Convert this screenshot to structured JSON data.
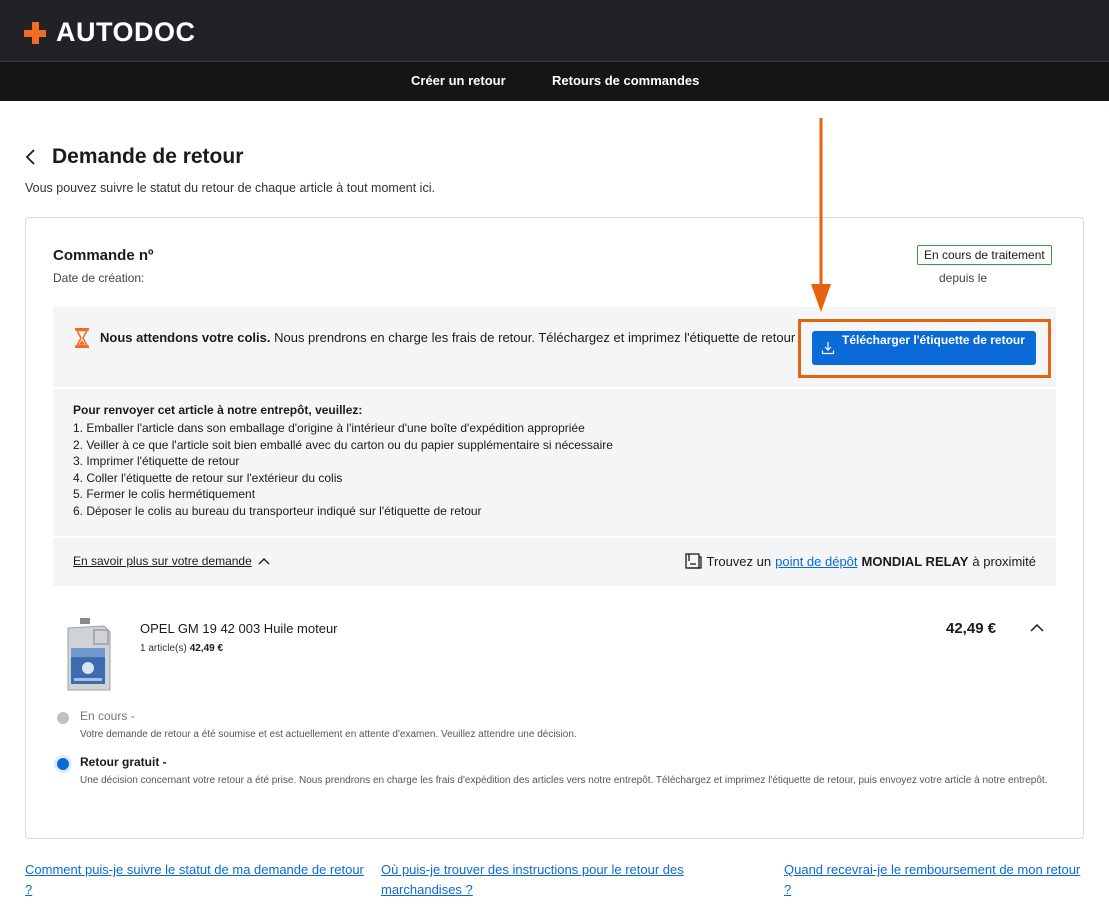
{
  "brand": {
    "name": "AUTODOC",
    "accent": "#f26b21",
    "primary": "#0a6ad8"
  },
  "nav": {
    "create_return": "Créer un retour",
    "order_returns": "Retours de commandes"
  },
  "page": {
    "title": "Demande de retour",
    "subtitle": "Vous pouvez suivre le statut du retour de chaque article à tout moment ici."
  },
  "order": {
    "title": "Commande nº",
    "date_label": "Date de création:",
    "status": "En cours de traitement",
    "since": "depuis le"
  },
  "notice": {
    "bold": "Nous attendons votre colis.",
    "text": " Nous prendrons en charge les frais de retour. Téléchargez et imprimez l'étiquette de retour",
    "button": "Télécharger l'étiquette de retour",
    "icon": "hourglass-icon"
  },
  "instructions": {
    "title": "Pour renvoyer cet article à notre entrepôt, veuillez:",
    "steps": [
      "1. Emballer l'article dans son emballage d'origine à l'intérieur d'une boîte d'expédition appropriée",
      "2. Veiller à ce que l'article soit bien emballé avec du carton ou du papier supplémentaire si nécessaire",
      "3. Imprimer l'étiquette de retour",
      "4. Coller l'étiquette de retour sur l'extérieur du colis",
      "5. Fermer le colis hermétiquement",
      "6. Déposer le colis au bureau du transporteur indiqué sur l'étiquette de retour"
    ]
  },
  "learn_more": "En savoir plus sur votre demande",
  "relay": {
    "prefix": "Trouvez un",
    "link": "point de dépôt",
    "carrier": "MONDIAL RELAY",
    "suffix": "à proximité"
  },
  "product": {
    "name": "OPEL GM 19 42 003 Huile moteur",
    "qty": "1 article(s)",
    "unit_price": "42,49 €",
    "price": "42,49 €"
  },
  "timeline": [
    {
      "title": "En cours -",
      "desc": "Votre demande de retour a été soumise et est actuellement en attente d'examen. Veuillez attendre une décision."
    },
    {
      "title": "Retour gratuit -",
      "desc": "Une décision concernant votre retour a été prise. Nous prendrons en charge les frais d'expédition des articles vers notre entrepôt. Téléchargez et imprimez l'étiquette de retour, puis envoyez votre article à notre entrepôt."
    }
  ],
  "faq": [
    "Comment puis-je suivre le statut de ma demande de retour ?",
    "Où puis-je trouver des instructions pour le retour des marchandises ?",
    "Quand recevrai-je le remboursement de mon retour ?"
  ]
}
